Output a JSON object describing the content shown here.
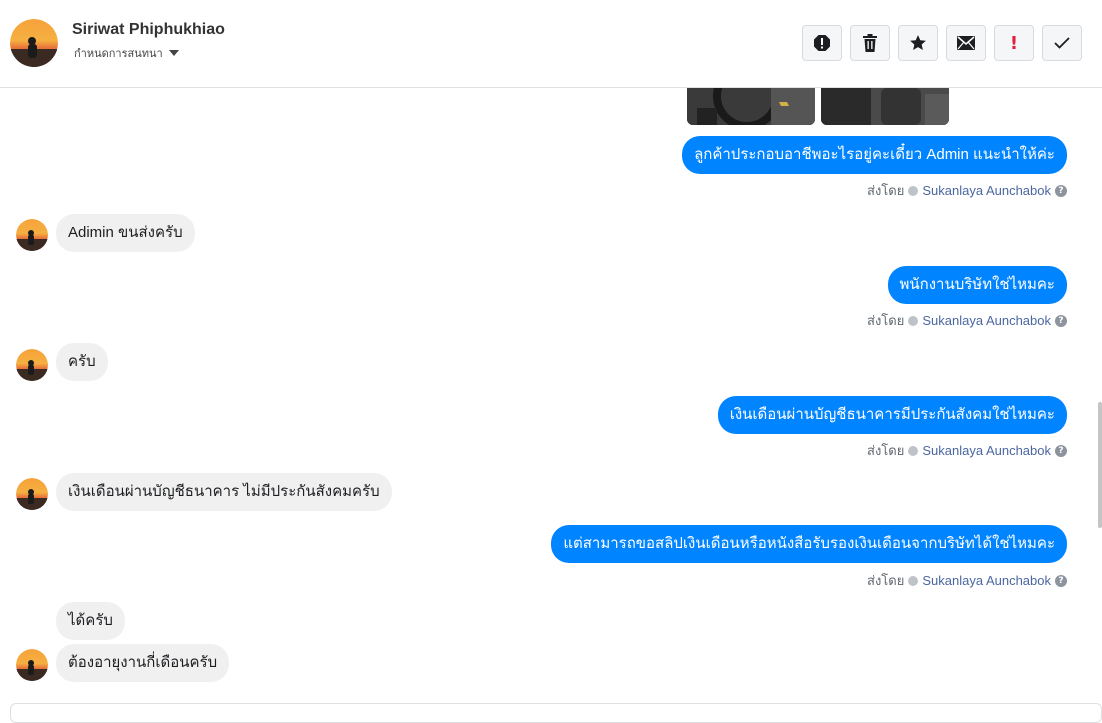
{
  "header": {
    "contact_name": "Siriwat Phiphukhiao",
    "conversation_settings": "กำหนดการสนทนา",
    "toolbar": [
      "alert-icon",
      "trash-icon",
      "star-icon",
      "mail-icon",
      "exclamation-icon",
      "check-icon"
    ],
    "exclamation_label": "!"
  },
  "messages": {
    "m1": "ลูกค้าประกอบอาชีพอะไรอยู่คะเดี๋ยว Admin แนะนำให้ค่ะ",
    "m2": "Adimin ขนส่งครับ",
    "m3": "พนักงานบริษัทใช่ไหมคะ",
    "m4": "ครับ",
    "m5": "เงินเดือนผ่านบัญชีธนาคารมีประกันสังคมใช่ไหมคะ",
    "m6": "เงินเดือนผ่านบัญชีธนาคาร ไม่มีประกันสังคมครับ",
    "m7": "แต่สามารถขอสลิปเงินเดือนหรือหนังสือรับรองเงินเดือนจากบริษัทได้ใช่ไหมคะ",
    "m8": "ได้ครับ",
    "m9": "ต้องอายุงานกี่เดือนครับ"
  },
  "sent_by": {
    "label": "ส่งโดย",
    "agent": "Sukanlaya Aunchabok",
    "help": "?"
  },
  "colors": {
    "outgoing": "#0084ff",
    "incoming": "#f1f0f0",
    "agent": "#4b67a1"
  }
}
